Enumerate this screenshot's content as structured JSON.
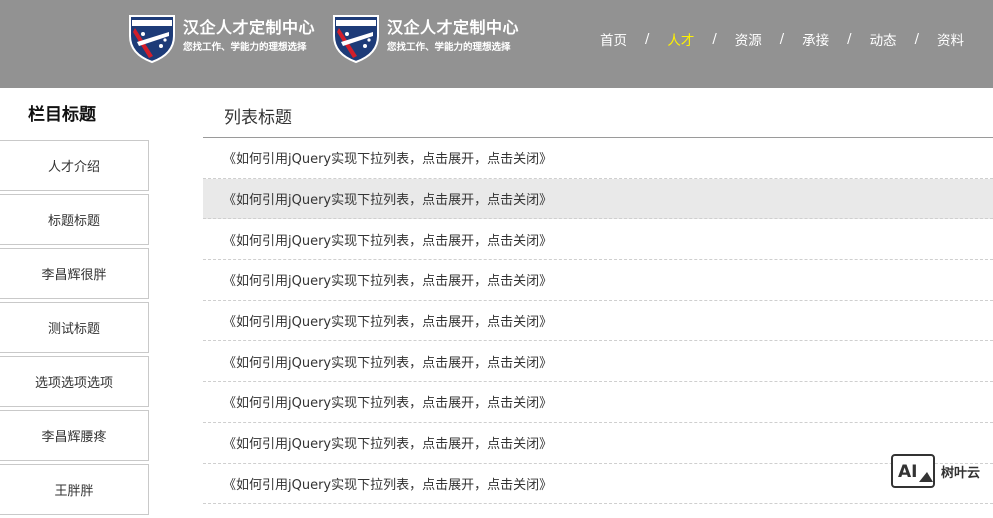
{
  "header": {
    "brands": [
      {
        "title": "汉企人才定制中心",
        "subtitle": "您找工作、学能力的理想选择"
      },
      {
        "title": "汉企人才定制中心",
        "subtitle": "您找工作、学能力的理想选择"
      }
    ],
    "nav": [
      {
        "label": "首页"
      },
      {
        "label": "人才"
      },
      {
        "label": "资源"
      },
      {
        "label": "承接"
      },
      {
        "label": "动态"
      },
      {
        "label": "资料"
      }
    ],
    "nav_separator": "/",
    "active_nav": "人才",
    "colors": {
      "header_bg": "#929292",
      "active_nav": "#fff200"
    }
  },
  "sidebar": {
    "title": "栏目标题",
    "items": [
      {
        "label": "人才介绍"
      },
      {
        "label": "标题标题"
      },
      {
        "label": "李昌辉很胖"
      },
      {
        "label": "测试标题"
      },
      {
        "label": "选项选项选项"
      },
      {
        "label": "李昌辉腰疼"
      },
      {
        "label": "王胖胖"
      }
    ]
  },
  "main": {
    "title": "列表标题",
    "items": [
      {
        "text": "《如何引用jQuery实现下拉列表，点击展开，点击关闭》"
      },
      {
        "text": "《如何引用jQuery实现下拉列表，点击展开，点击关闭》"
      },
      {
        "text": "《如何引用jQuery实现下拉列表，点击展开，点击关闭》"
      },
      {
        "text": "《如何引用jQuery实现下拉列表，点击展开，点击关闭》"
      },
      {
        "text": "《如何引用jQuery实现下拉列表，点击展开，点击关闭》"
      },
      {
        "text": "《如何引用jQuery实现下拉列表，点击展开，点击关闭》"
      },
      {
        "text": "《如何引用jQuery实现下拉列表，点击展开，点击关闭》"
      },
      {
        "text": "《如何引用jQuery实现下拉列表，点击展开，点击关闭》"
      },
      {
        "text": "《如何引用jQuery实现下拉列表，点击展开，点击关闭》"
      }
    ],
    "highlighted_index": 1
  },
  "watermark": {
    "logo_text": "AI",
    "text": "树叶云"
  }
}
